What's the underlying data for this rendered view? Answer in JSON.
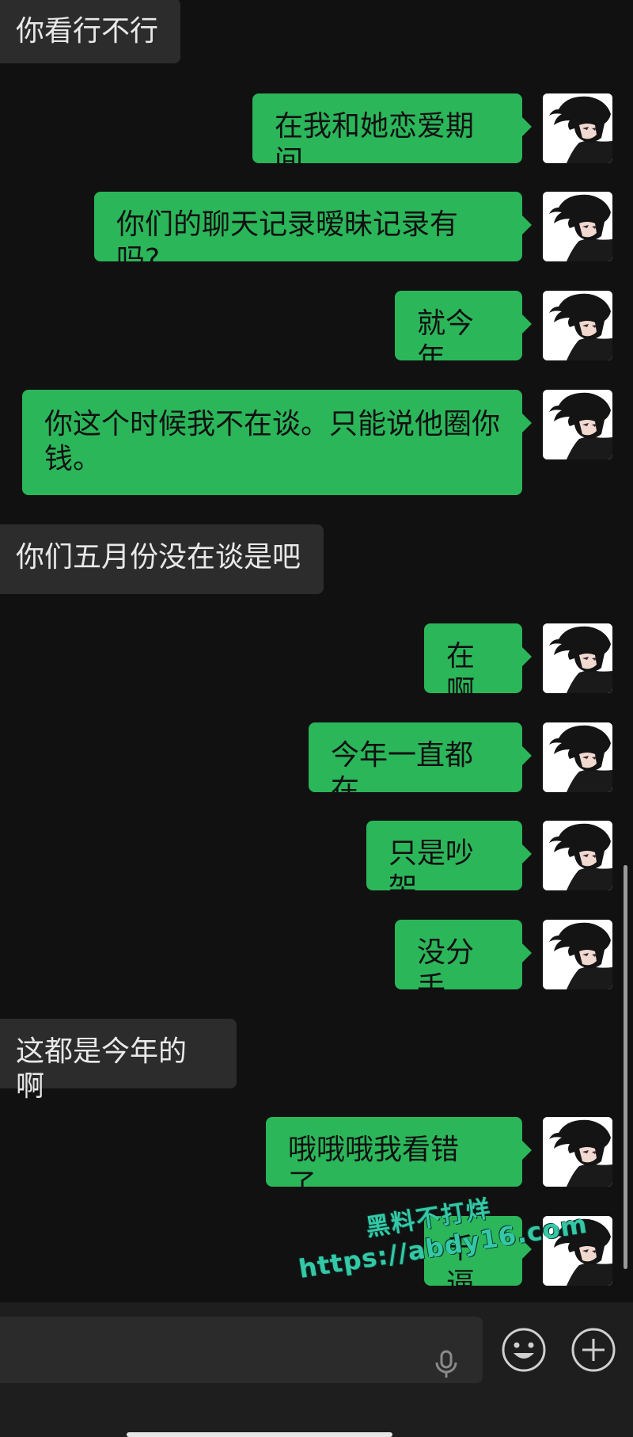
{
  "messages": [
    {
      "side": "received",
      "text": "你看行不行"
    },
    {
      "side": "sent",
      "text": "在我和她恋爱期间"
    },
    {
      "side": "sent",
      "text": "你们的聊天记录暧昧记录有吗?"
    },
    {
      "side": "sent",
      "text": "就今年"
    },
    {
      "side": "sent",
      "text": "你这个时候我不在谈。只能说他圈你\n钱。"
    },
    {
      "side": "received",
      "text": "你们五月份没在谈是吧"
    },
    {
      "side": "sent",
      "text": "在啊"
    },
    {
      "side": "sent",
      "text": "今年一直都在"
    },
    {
      "side": "sent",
      "text": "只是吵架"
    },
    {
      "side": "sent",
      "text": "没分手"
    },
    {
      "side": "received",
      "text": "这都是今年的啊"
    },
    {
      "side": "sent",
      "text": "哦哦哦我看错了。"
    },
    {
      "side": "sent",
      "text": "千逼"
    }
  ],
  "watermark": {
    "line1": "黑料不打烊",
    "line2": "https://abdy16.com"
  },
  "input_bar": {
    "mic_icon": "microphone-icon",
    "emoji_icon": "emoji-icon",
    "plus_icon": "plus-icon"
  },
  "colors": {
    "sent_bubble": "#2bb65a",
    "received_bubble": "#2c2c2c",
    "background": "#111111"
  }
}
